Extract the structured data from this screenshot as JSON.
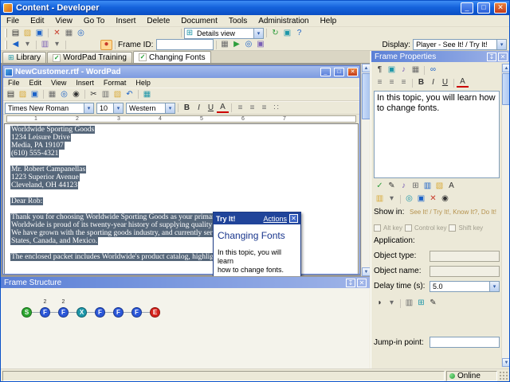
{
  "icons": {
    "min": "_",
    "max": "□",
    "close": "✕",
    "new": "▤",
    "open": "▨",
    "save": "▣",
    "print": "▦",
    "preview": "◎",
    "find": "◉",
    "cut": "✂",
    "copy": "▥",
    "paste": "▧",
    "undo": "↶",
    "date": "▦",
    "delete": "✕",
    "back": "◀",
    "dropdown": "▾",
    "record": "●",
    "play": "▶",
    "film": "▦",
    "grid": "⊞",
    "refresh": "↻",
    "help": "?",
    "image": "▣",
    "sound": "♪",
    "edit": "✎",
    "check": "✓",
    "align": "≡",
    "bullets": "∷",
    "bold": "B",
    "italic": "I",
    "underline": "U",
    "color": "A",
    "pin": "↧",
    "mouse": "◗",
    "text": "¶",
    "template": "▥",
    "link": "∞",
    "up": "▴"
  },
  "window": {
    "title": "Content - Developer",
    "menu_items": [
      "File",
      "Edit",
      "View",
      "Go To",
      "Insert",
      "Delete",
      "Document",
      "Tools",
      "Administration",
      "Help"
    ]
  },
  "toolbar": {
    "details_view": "Details view",
    "frame_id_label": "Frame ID:",
    "display_label": "Display:",
    "display_value": "Player - See It! / Try It!"
  },
  "tabs": {
    "library": "Library",
    "wordpad_training": "WordPad Training",
    "changing_fonts": "Changing Fonts"
  },
  "wordpad": {
    "title": "NewCustomer.rtf - WordPad",
    "menu_items": [
      "File",
      "Edit",
      "View",
      "Insert",
      "Format",
      "Help"
    ],
    "font_name": "Times New Roman",
    "font_size": "10",
    "charset": "Western",
    "ruler_numbers": [
      "1",
      "2",
      "3",
      "4",
      "5",
      "6",
      "7"
    ],
    "doc_lines": [
      "Worldwide Sporting Goods",
      "1234 Leisure Drive",
      "Media, PA 19107",
      "(610) 555-4321",
      "",
      "Mr. Robert Campanellas",
      "1223 Superior Avenue",
      "Cleveland, OH  44123",
      "",
      "Dear Rob:",
      "",
      "Thank you for choosing Worldwide Sporting Goods as your primary supplier of sporting",
      "Worldwide is proud of its twenty-year history of supplying quality products at reasonable",
      "We have grown with the sporting goods industry, and currently serve customers in the United",
      "States, Canada, and Mexico.",
      "",
      "The enclosed packet includes Worldwide's product catalog, highlights of the products and"
    ]
  },
  "tryit": {
    "title": "Try It!",
    "actions": "Actions",
    "heading": "Changing Fonts",
    "line1": "In this topic, you will learn",
    "line2": "how to change fonts."
  },
  "frame_properties": {
    "title": "Frame Properties",
    "text": "In this topic, you will learn how to change fonts.",
    "show_in_label": "Show in:",
    "show_in_value": "See It! / Try It!, Know It?, Do It!",
    "alt_key": "Alt key",
    "control_key": "Control key",
    "shift_key": "Shift key",
    "application_label": "Application:",
    "object_type_label": "Object type:",
    "object_name_label": "Object name:",
    "delay_label": "Delay time (s):",
    "delay_value": "5.0",
    "jump_in_label": "Jump-in point:"
  },
  "frame_structure": {
    "title": "Frame Structure",
    "nodes": [
      {
        "label": "S",
        "color": "#2BA52E"
      },
      {
        "label": "F",
        "color": "#2B57D8",
        "count": "2"
      },
      {
        "label": "F",
        "color": "#2B57D8",
        "count": "2"
      },
      {
        "label": "X",
        "color": "#1D96A8"
      },
      {
        "label": "F",
        "color": "#2B57D8"
      },
      {
        "label": "F",
        "color": "#2B57D8"
      },
      {
        "label": "F",
        "color": "#2B57D8"
      },
      {
        "label": "E",
        "color": "#D6231C"
      }
    ]
  },
  "status": {
    "online": "Online"
  },
  "colors": {
    "selection": "#56677A",
    "titlebar_blue": "#1563DC",
    "panel_header_blue": "#5B80D6"
  }
}
